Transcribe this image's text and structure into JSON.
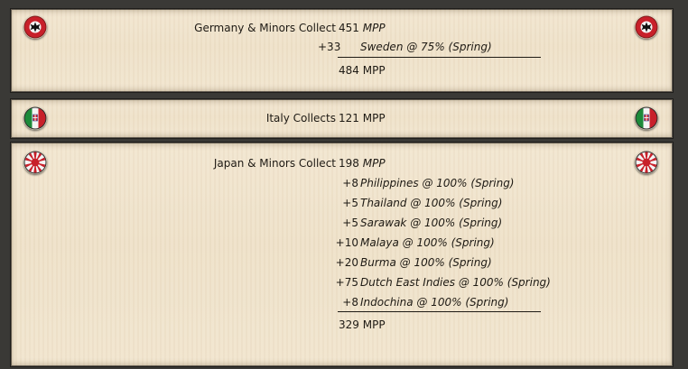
{
  "germany": {
    "header_label": "Germany & Minors Collect",
    "base_value": "451",
    "base_unit": "MPP",
    "items": [
      {
        "amount": "+33",
        "detail": "Sweden @ 75% (Spring)"
      }
    ],
    "total_value": "484",
    "total_unit": "MPP",
    "icon": "iron-cross-roundel-icon",
    "colors": {
      "roundel_red": "#c8202a",
      "cross": "#111111"
    }
  },
  "italy": {
    "header_label": "Italy Collects",
    "base_value": "121",
    "base_unit": "MPP",
    "icon": "italy-flag-roundel-icon",
    "colors": {
      "green": "#1d8a3a",
      "white": "#f4f4f4",
      "red": "#c8202a"
    }
  },
  "japan": {
    "header_label": "Japan & Minors Collect",
    "base_value": "198",
    "base_unit": "MPP",
    "items": [
      {
        "amount": "+8",
        "detail": "Philippines @ 100% (Spring)"
      },
      {
        "amount": "+5",
        "detail": "Thailand @ 100% (Spring)"
      },
      {
        "amount": "+5",
        "detail": "Sarawak @ 100% (Spring)"
      },
      {
        "amount": "+10",
        "detail": "Malaya @ 100% (Spring)"
      },
      {
        "amount": "+20",
        "detail": "Burma @ 100% (Spring)"
      },
      {
        "amount": "+75",
        "detail": "Dutch East Indies @ 100% (Spring)"
      },
      {
        "amount": "+8",
        "detail": "Indochina @ 100% (Spring)"
      }
    ],
    "total_value": "329",
    "total_unit": "MPP",
    "icon": "rising-sun-roundel-icon",
    "colors": {
      "sun": "#c8202a",
      "field": "#f4f4f4"
    }
  },
  "theme": {
    "background": "#3a3936",
    "parchment": "#f0e4cc",
    "text": "#1e1a14"
  }
}
